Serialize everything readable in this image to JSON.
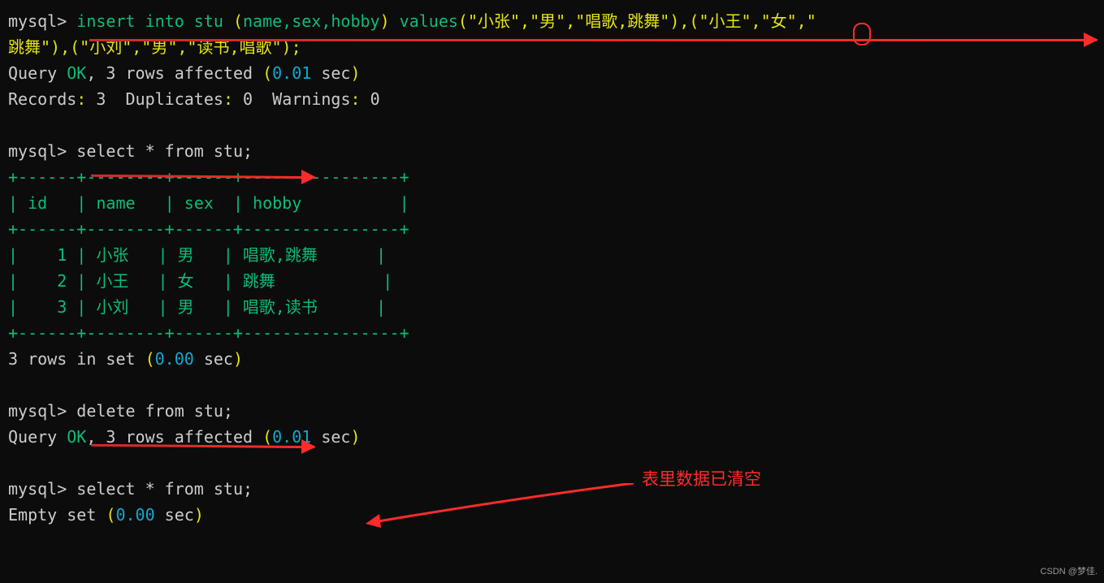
{
  "prompts": {
    "mysql": "mysql>"
  },
  "line1": {
    "cmd_a": " insert into stu ",
    "paren_open": "(",
    "fields": "name,sex,hobby",
    "paren_close": ")",
    "values_kw": " values",
    "vals_a": "(\"小张\",\"男\",\"唱歌,跳舞\"),(\"小王\",\"女\",\""
  },
  "line2": {
    "cont": "跳舞\"),(\"小刘\",\"男\",\"读书,唱歌\");"
  },
  "line3": {
    "a": "Query ",
    "ok": "OK",
    "b": ", 3 rows affected ",
    "p_open": "(",
    "time": "0.01",
    "sec": " sec",
    "p_close": ")"
  },
  "line4": {
    "a": "Records",
    "b": ":",
    "c": " 3  ",
    "d": "Duplicates",
    "e": ":",
    "f": " 0  ",
    "g": "Warnings",
    "h": ":",
    "i": " 0"
  },
  "line_sel1": {
    "cmd": " select * from stu;"
  },
  "tbl": {
    "border": "+------+--------+------+----------------+",
    "header": "| id   | name   | sex  | hobby          |",
    "row1": "|    1 | 小张   | 男   | 唱歌,跳舞      |",
    "row2": "|    2 | 小王   | 女   | 跳舞           |",
    "row3": "|    3 | 小刘   | 男   | 唱歌,读书      |"
  },
  "rows3": {
    "a": "3 rows in set ",
    "p_open": "(",
    "time": "0.00",
    "sec": " sec",
    "p_close": ")"
  },
  "del": {
    "cmd": " delete from stu;"
  },
  "del_res": {
    "a": "Query ",
    "ok": "OK",
    "b": ", 3 rows affected ",
    "p_open": "(",
    "time": "0.01",
    "sec": " sec",
    "p_close": ")"
  },
  "sel2": {
    "cmd": " select * from stu;"
  },
  "empty": {
    "a": "Empty set ",
    "p_open": "(",
    "time": "0.00",
    "sec": " sec",
    "p_close": ")"
  },
  "annotation": "表里数据已清空",
  "watermark": "CSDN @梦佳."
}
